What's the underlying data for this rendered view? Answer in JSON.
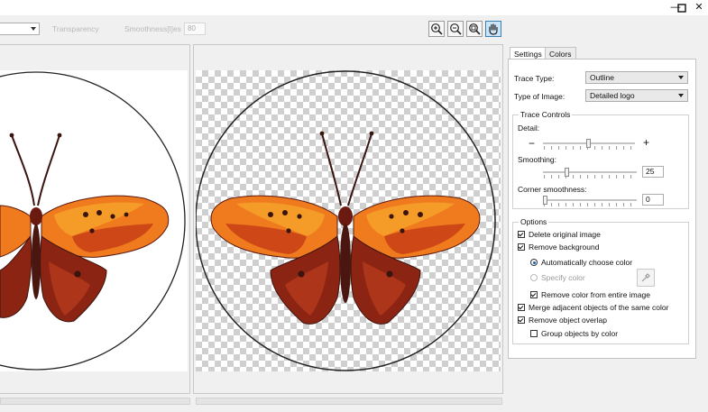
{
  "window": {
    "minimize_glyph": "—",
    "maximize_glyph": "□",
    "close_glyph": "✕"
  },
  "toolbar": {
    "faded_label_1": "Transparency",
    "faded_label_2": "Smoothness[l]es",
    "faded_value": "80",
    "zoom_buttons": [
      "zoom-in-icon",
      "zoom-out-icon",
      "zoom-fit-icon",
      "pan-hand-icon"
    ],
    "active_tool": "pan-hand-icon"
  },
  "panel": {
    "tabs": [
      "Settings",
      "Colors"
    ],
    "selected_tab": "Settings",
    "trace_type_label": "Trace Type:",
    "trace_type_value": "Outline",
    "image_type_label": "Type of Image:",
    "image_type_value": "Detailed logo",
    "trace_controls": {
      "title": "Trace Controls",
      "detail_label": "Detail:",
      "detail_minus": "−",
      "detail_plus": "+",
      "detail_level": 0.5,
      "smoothing_label": "Smoothing:",
      "smoothing_value": "25",
      "corner_label": "Corner smoothness:",
      "corner_value": "0"
    },
    "options": {
      "title": "Options",
      "delete_original": {
        "label": "Delete original image",
        "checked": true
      },
      "remove_background": {
        "label": "Remove background",
        "checked": true
      },
      "auto_color": {
        "label": "Automatically choose color",
        "selected": true
      },
      "specify_color": {
        "label": "Specify color",
        "selected": false
      },
      "remove_color_entire": {
        "label": "Remove color from entire image",
        "checked": true
      },
      "merge_adjacent": {
        "label": "Merge adjacent objects of the same color",
        "checked": true
      },
      "remove_overlap": {
        "label": "Remove object overlap",
        "checked": true
      },
      "group_by_color": {
        "label": "Group objects by color",
        "checked": false
      }
    }
  },
  "colors": {
    "accent": "#1a5fb4",
    "wing_orange": "#f07a1e",
    "wing_dark": "#7a1f14",
    "body": "#3a140e"
  }
}
